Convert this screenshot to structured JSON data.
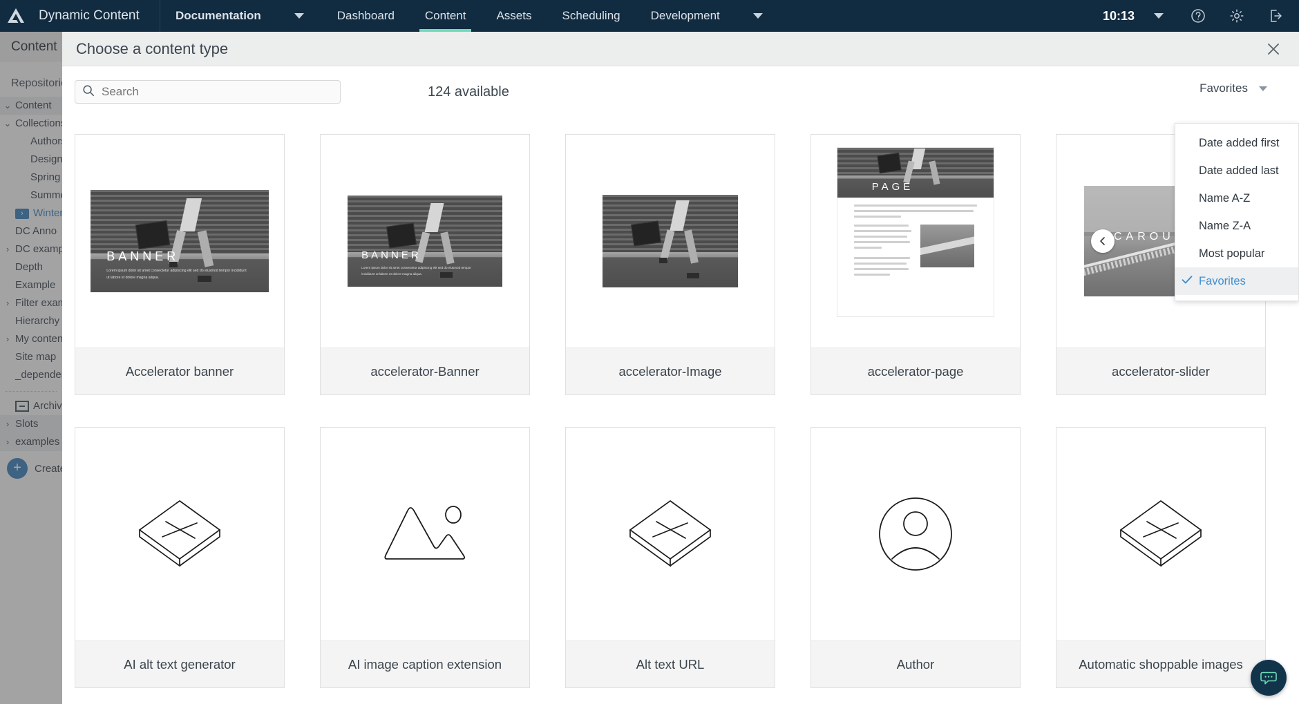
{
  "topnav": {
    "logo_icon": "amplience-logo-icon",
    "brand": "Dynamic Content",
    "items": [
      {
        "label": "Documentation",
        "bold": true,
        "active": false,
        "caret": true
      },
      {
        "label": "Dashboard",
        "bold": false,
        "active": false,
        "caret": false
      },
      {
        "label": "Content",
        "bold": false,
        "active": true,
        "caret": false
      },
      {
        "label": "Assets",
        "bold": false,
        "active": false,
        "caret": false
      },
      {
        "label": "Scheduling",
        "bold": false,
        "active": false,
        "caret": false
      },
      {
        "label": "Development",
        "bold": false,
        "active": false,
        "caret": true
      }
    ],
    "time": "10:13",
    "time_caret_icon": "chevron-down-icon",
    "help_icon": "help-circle-icon",
    "settings_icon": "gear-icon",
    "signout_icon": "sign-out-icon",
    "accent_color": "#6fdbb7",
    "background_color": "#112b40"
  },
  "sidebar": {
    "title": "Content",
    "section_label": "Repositories",
    "items": [
      {
        "label": "Content",
        "indent": 0,
        "chevron": "down",
        "selected": true
      },
      {
        "label": "Collections",
        "indent": 0,
        "chevron": "down",
        "selected": false
      },
      {
        "label": "Authors",
        "indent": 2,
        "chevron": "",
        "selected": false
      },
      {
        "label": "Design",
        "indent": 2,
        "chevron": "",
        "selected": false
      },
      {
        "label": "Spring",
        "indent": 2,
        "chevron": "",
        "selected": false
      },
      {
        "label": "Summer",
        "indent": 2,
        "chevron": "",
        "selected": false
      },
      {
        "label": "Winter",
        "indent": 1,
        "chevron": "",
        "selected": false,
        "icon": "folder-shortcut-icon",
        "highlight": true
      },
      {
        "label": "DC Anno",
        "indent": 1,
        "chevron": "",
        "selected": false
      },
      {
        "label": "DC example",
        "indent": 0,
        "chevron": "right",
        "selected": false
      },
      {
        "label": "Depth",
        "indent": 1,
        "chevron": "",
        "selected": false
      },
      {
        "label": "Example",
        "indent": 1,
        "chevron": "",
        "selected": false
      },
      {
        "label": "Filter example",
        "indent": 0,
        "chevron": "right",
        "selected": false
      },
      {
        "label": "Hierarchy",
        "indent": 1,
        "chevron": "",
        "selected": false
      },
      {
        "label": "My content",
        "indent": 0,
        "chevron": "right",
        "selected": false
      },
      {
        "label": "Site map",
        "indent": 1,
        "chevron": "",
        "selected": false
      },
      {
        "label": "_dependencies",
        "indent": 1,
        "chevron": "",
        "selected": false
      }
    ],
    "archive_label": "Archived",
    "archive_icon": "archive-box-icon",
    "bottom_items": [
      {
        "label": "Slots",
        "chevron": "right"
      },
      {
        "label": "examples",
        "chevron": "right"
      }
    ],
    "create_label": "Create",
    "create_icon": "plus-circle-icon"
  },
  "modal": {
    "title": "Choose a content type",
    "close_icon": "close-icon",
    "search": {
      "icon": "search-icon",
      "placeholder": "Search",
      "value": ""
    },
    "available_count": "124 available",
    "sort": {
      "selected_label": "Favorites",
      "caret_icon": "chevron-down-icon",
      "options": [
        {
          "label": "Date added first",
          "checked": false
        },
        {
          "label": "Date added last",
          "checked": false
        },
        {
          "label": "Name A-Z",
          "checked": false
        },
        {
          "label": "Name Z-A",
          "checked": false
        },
        {
          "label": "Most popular",
          "checked": false
        },
        {
          "label": "Favorites",
          "checked": true
        }
      ],
      "check_icon": "check-icon",
      "checked_color": "#3f8fd0"
    },
    "cards": [
      [
        {
          "label": "Accelerator banner",
          "preview": "banner",
          "hero_text": "BANNER",
          "body_text": "Lorem ipsum dolor sit amet consectetur adipiscing elit sed do eiusmod tempor incididunt ut labore et dolore magna aliqua."
        },
        {
          "label": "accelerator-Banner",
          "preview": "banner-small",
          "hero_text": "BANNER",
          "body_text": "Lorem ipsum dolor sit amet consectetur adipiscing elit sed do eiusmod tempor incididunt ut labore et dolore magna aliqua."
        },
        {
          "label": "accelerator-Image",
          "preview": "image",
          "hero_text": "",
          "body_text": ""
        },
        {
          "label": "accelerator-page",
          "preview": "page",
          "hero_text": "PAGE",
          "body_text": ""
        },
        {
          "label": "accelerator-slider",
          "preview": "carousel",
          "hero_text": "CAROUSEL",
          "prev_arrow_icon": "chevron-left-icon",
          "body_text": ""
        }
      ],
      [
        {
          "label": "AI alt text generator",
          "preview": "icon",
          "icon": "content-type-placeholder-icon"
        },
        {
          "label": "AI image caption extension",
          "preview": "icon",
          "icon": "image-placeholder-icon"
        },
        {
          "label": "Alt text URL",
          "preview": "icon",
          "icon": "content-type-placeholder-icon"
        },
        {
          "label": "Author",
          "preview": "icon",
          "icon": "person-avatar-icon"
        },
        {
          "label": "Automatic shoppable images",
          "preview": "icon",
          "icon": "content-type-placeholder-icon"
        }
      ]
    ]
  },
  "chat": {
    "icon": "chat-bubble-icon",
    "background_color": "#12344b",
    "accent_color": "#6fdbb7"
  }
}
